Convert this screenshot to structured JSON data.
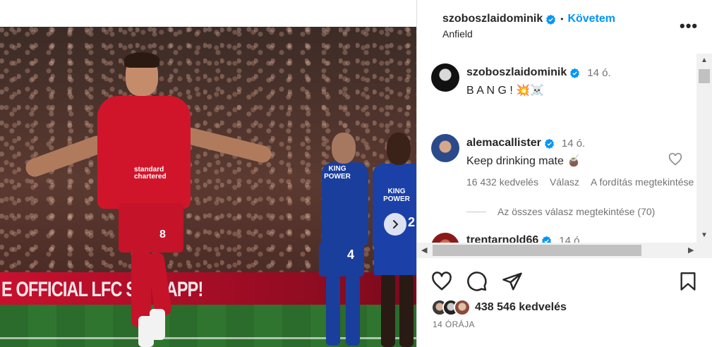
{
  "post": {
    "board_text": "E OFFICIAL LFC SC   E APP!",
    "sponsor_text": "standard chartered",
    "player_number": "8",
    "opponent_sponsor": "KING POWER",
    "opponent_number_1": "4",
    "opponent_number_2": "2"
  },
  "header": {
    "username": "szoboszlaidominik",
    "separator": "•",
    "follow_label": "Követem",
    "location": "Anfield",
    "more_label": "•••"
  },
  "comments": [
    {
      "username": "szoboszlaidominik",
      "time": "14 ó.",
      "text": "B A N G ! 💥☠️"
    },
    {
      "username": "alemacallister",
      "time": "14 ó.",
      "text": "Keep drinking mate 🧉",
      "likes": "16 432 kedvelés",
      "reply_label": "Válasz",
      "translate_label": "A fordítás megtekintése",
      "view_replies": "Az összes válasz megtekintése (70)"
    },
    {
      "username": "trentarnold66",
      "time": "14 ó."
    }
  ],
  "footer": {
    "likes_count": "438 546 kedvelés",
    "timestamp": "14 ÓRÁJA"
  },
  "colors": {
    "accent": "#0095f6",
    "verified": "#0095f6",
    "text_primary": "#262626",
    "text_secondary": "#737373"
  }
}
